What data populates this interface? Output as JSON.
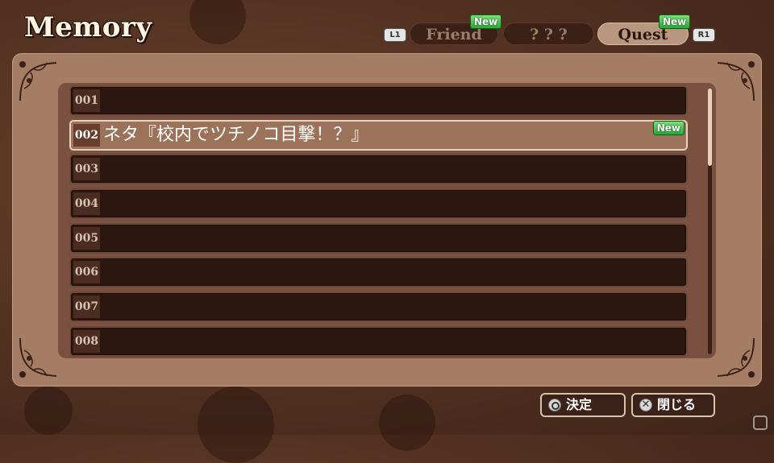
{
  "header": {
    "title": "Memory",
    "l1_label": "L1",
    "r1_label": "R1",
    "tabs": [
      {
        "label": "Friend",
        "badge": "New",
        "active": false
      },
      {
        "label": "? ? ?",
        "badge": "",
        "active": false
      },
      {
        "label": "Quest",
        "badge": "New",
        "active": true
      }
    ]
  },
  "list": {
    "rows": [
      {
        "num": "001",
        "title": ""
      },
      {
        "num": "002",
        "title": "ネタ『校内でツチノコ目撃！？』",
        "badge": "New",
        "selected": true
      },
      {
        "num": "003",
        "title": ""
      },
      {
        "num": "004",
        "title": ""
      },
      {
        "num": "005",
        "title": ""
      },
      {
        "num": "006",
        "title": ""
      },
      {
        "num": "007",
        "title": ""
      },
      {
        "num": "008",
        "title": ""
      }
    ]
  },
  "actions": {
    "confirm_label": "決定",
    "close_label": "閉じる",
    "confirm_icon": "circle-button-icon",
    "close_icon": "cross-button-icon",
    "close_glyph": "✕"
  },
  "colors": {
    "panel": "#a57d64",
    "row": "#2b1610",
    "selected_row": "#9d725a",
    "new_badge": "#2aa838"
  }
}
